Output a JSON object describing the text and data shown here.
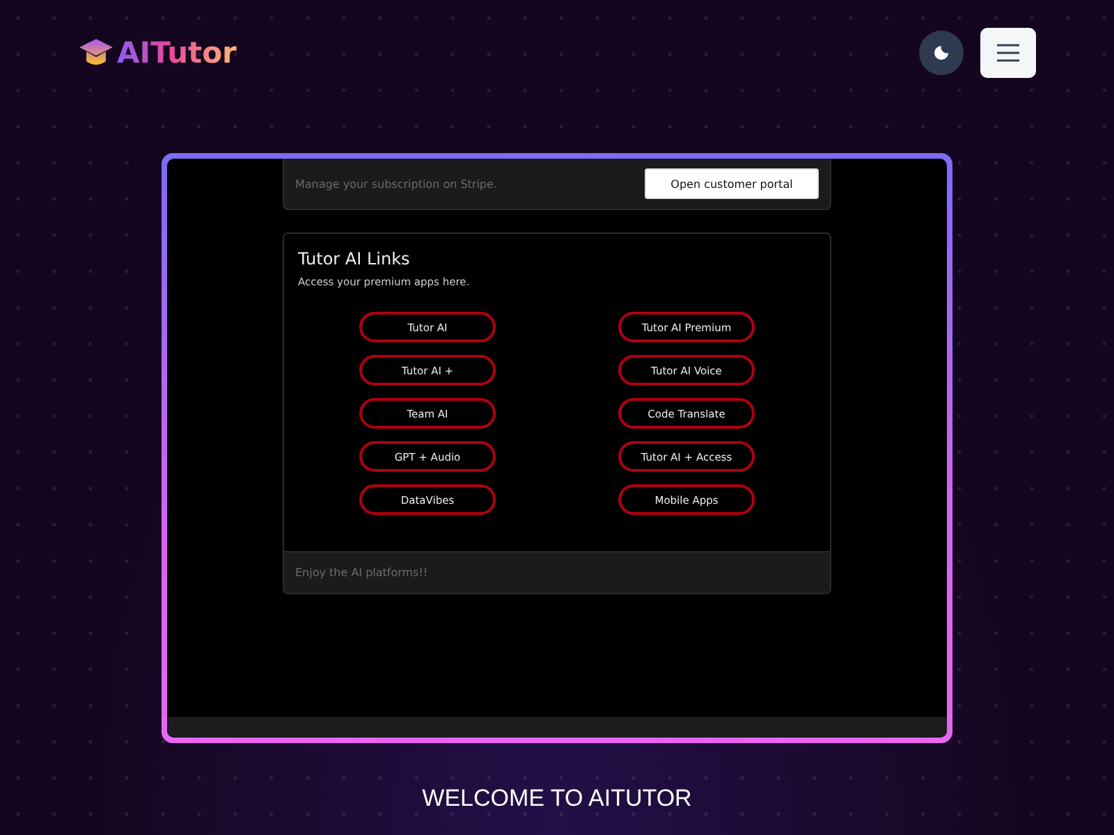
{
  "header": {
    "logo": "AITutor"
  },
  "subscription": {
    "text": "Manage your subscription on Stripe.",
    "button": "Open customer portal"
  },
  "links_card": {
    "title": "Tutor AI Links",
    "subtitle": "Access your premium apps here.",
    "links": [
      "Tutor AI",
      "Tutor AI Premium",
      "Tutor AI +",
      "Tutor AI Voice",
      "Team AI",
      "Code Translate",
      "GPT + Audio",
      "Tutor AI + Access",
      "DataVibes",
      "Mobile Apps"
    ],
    "footer": "Enjoy the AI platforms!!"
  },
  "welcome": "WELCOME TO AITUTOR"
}
